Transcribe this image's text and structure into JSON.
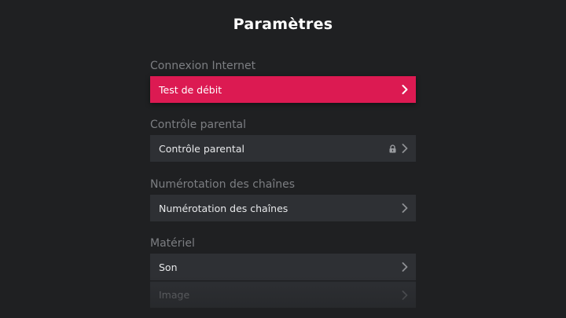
{
  "header": {
    "title": "Paramètres"
  },
  "sections": [
    {
      "title": "Connexion Internet",
      "items": [
        {
          "label": "Test de débit",
          "selected": true,
          "locked": false
        }
      ]
    },
    {
      "title": "Contrôle parental",
      "items": [
        {
          "label": "Contrôle parental",
          "selected": false,
          "locked": true
        }
      ]
    },
    {
      "title": "Numérotation des chaînes",
      "items": [
        {
          "label": "Numérotation des chaînes",
          "selected": false,
          "locked": false
        }
      ]
    },
    {
      "title": "Matériel",
      "items": [
        {
          "label": "Son",
          "selected": false,
          "locked": false
        },
        {
          "label": "Image",
          "selected": false,
          "locked": false
        }
      ]
    }
  ],
  "icons": {
    "chevron": "chevron-right-icon",
    "lock": "lock-icon"
  },
  "colors": {
    "background": "#1f2022",
    "accent": "#dc1a52",
    "row": "#2e3034",
    "section_header": "#7c7e82"
  }
}
